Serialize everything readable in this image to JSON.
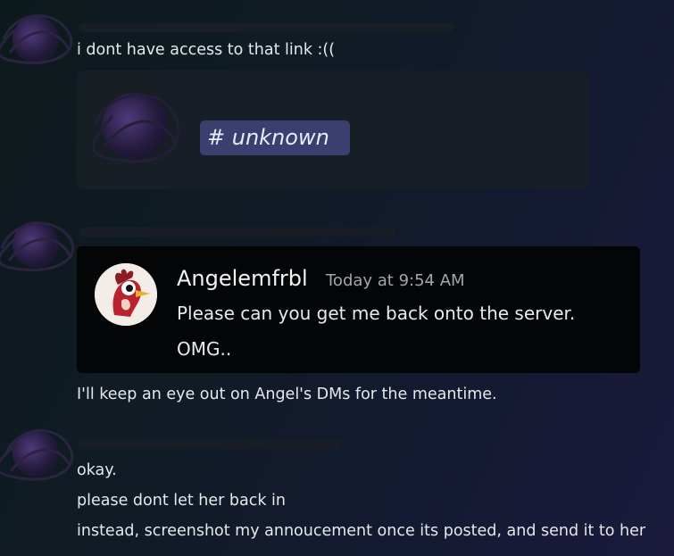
{
  "messages": [
    {
      "text": "i dont have access to that link :(("
    },
    {
      "text": "I'll keep an eye out on Angel's DMs for the meantime."
    },
    {
      "lines": [
        "okay.",
        "please dont let her back in",
        "instead, screenshot my annoucement once its posted, and send it to her"
      ]
    }
  ],
  "embed": {
    "channel": "# unknown"
  },
  "quote": {
    "author": "Angelemfrbl",
    "time": "Today at 9:54 AM",
    "lines": [
      "Please can you get me back onto the server.",
      "OMG.."
    ]
  },
  "colors": {
    "channel_pill": "#3a3f6f",
    "quote_bg": "#040506"
  }
}
